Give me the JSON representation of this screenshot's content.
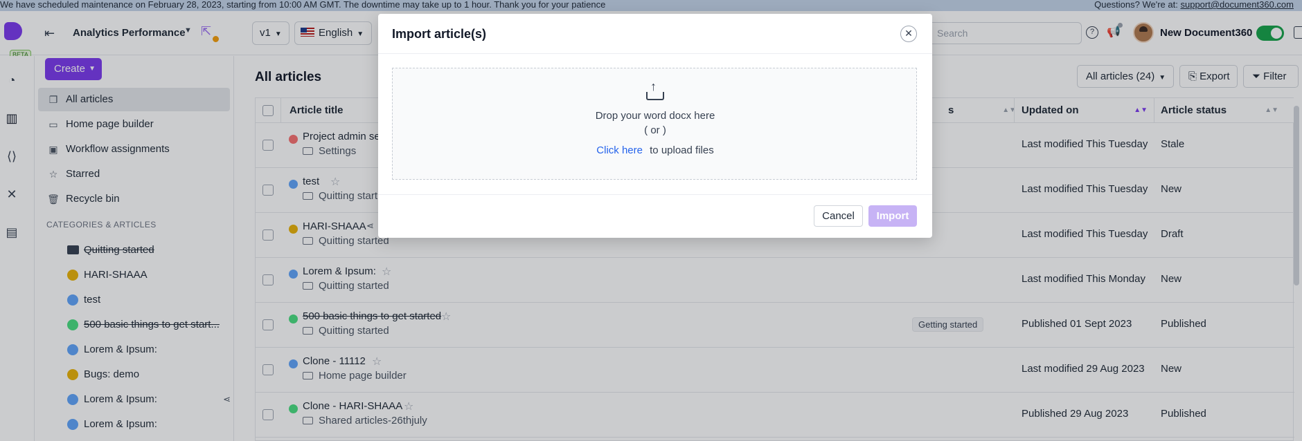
{
  "banner": {
    "message": "We have scheduled maintenance on February 28, 2023, starting from 10:00 AM GMT. The downtime may take up to 1 hour. Thank you for your patience",
    "contact_prefix": "Questions? We're at:",
    "contact_email": "support@document360.com"
  },
  "topbar": {
    "logo_badge": "BETA",
    "project_name": "Analytics Performance",
    "version": "v1",
    "language": "English",
    "search_placeholder": "Search",
    "user_name": "New Document360"
  },
  "sidebar": {
    "create_label": "Create",
    "items": [
      {
        "label": "All articles",
        "icon": "articles-icon"
      },
      {
        "label": "Home page builder",
        "icon": "monitor-icon"
      },
      {
        "label": "Workflow assignments",
        "icon": "workflow-icon"
      },
      {
        "label": "Starred",
        "icon": "star-icon"
      },
      {
        "label": "Recycle bin",
        "icon": "trash-icon"
      }
    ],
    "categories_header": "CATEGORIES & ARTICLES",
    "categories": [
      {
        "label": "Quitting started",
        "type": "folder",
        "strike": true
      },
      {
        "label": "HARI-SHAAA",
        "color": "#eab308"
      },
      {
        "label": "test",
        "color": "#60a5fa"
      },
      {
        "label": "500 basic things to get start...",
        "color": "#4ade80",
        "strike": true
      },
      {
        "label": "Lorem & Ipsum:",
        "color": "#60a5fa"
      },
      {
        "label": "Bugs: demo",
        "color": "#eab308"
      },
      {
        "label": "Lorem & Ipsum:",
        "color": "#60a5fa",
        "share": true
      },
      {
        "label": "Lorem & Ipsum:",
        "color": "#60a5fa"
      }
    ]
  },
  "main": {
    "title": "All articles",
    "filter_all": "All articles (24)",
    "export_label": "Export",
    "filter_label": "Filter",
    "columns": {
      "title": "Article title",
      "tags": "s",
      "updated": "Updated on",
      "status": "Article status"
    },
    "rows": [
      {
        "title": "Project admin se",
        "category": "Settings",
        "dot": "#f87171",
        "updated": "Last modified This Tuesday",
        "status": "Stale"
      },
      {
        "title": "test",
        "category": "Quitting start",
        "dot": "#60a5fa",
        "star": true,
        "updated": "Last modified This Tuesday",
        "status": "New"
      },
      {
        "title": "HARI-SHAAA",
        "category": "Quitting started",
        "dot": "#eab308",
        "share": true,
        "updated": "Last modified This Tuesday",
        "status": "Draft"
      },
      {
        "title": "Lorem & Ipsum:",
        "category": "Quitting started",
        "dot": "#60a5fa",
        "star": true,
        "updated": "Last modified This Monday",
        "status": "New"
      },
      {
        "title": "500 basic things to get started",
        "category": "Quitting started",
        "dot": "#4ade80",
        "strike": true,
        "star": true,
        "tag": "Getting started",
        "updated": "Published 01 Sept 2023",
        "status": "Published"
      },
      {
        "title": "Clone - 11112",
        "category": "Home page builder",
        "dot": "#60a5fa",
        "star": true,
        "updated": "Last modified 29 Aug 2023",
        "status": "New"
      },
      {
        "title": "Clone - HARI-SHAAA",
        "category": "Shared articles-26thjuly",
        "dot": "#4ade80",
        "star": true,
        "updated": "Published 29 Aug 2023",
        "status": "Published"
      }
    ]
  },
  "modal": {
    "title": "Import article(s)",
    "drop_text": "Drop your word docx here",
    "or_text": "( or )",
    "click_link": "Click here",
    "click_suffix": "to upload files",
    "cancel_label": "Cancel",
    "import_label": "Import"
  }
}
